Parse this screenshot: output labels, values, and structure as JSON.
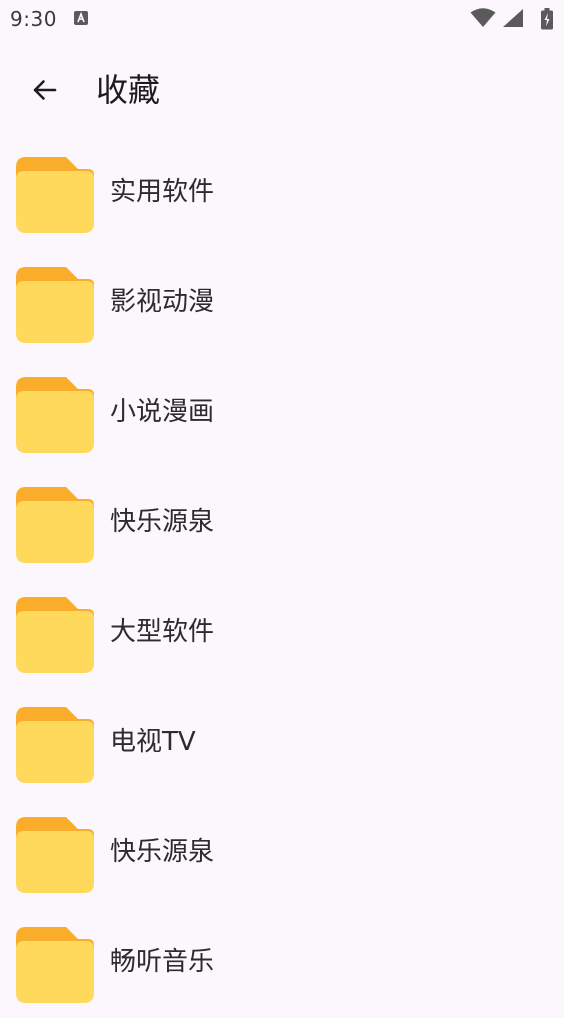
{
  "status_bar": {
    "time": "9:30",
    "icons": [
      "a-notification-icon",
      "wifi-icon",
      "signal-icon",
      "battery-icon"
    ]
  },
  "app_bar": {
    "back_icon": "arrow-back-icon",
    "title": "收藏"
  },
  "folders": [
    {
      "label": "实用软件"
    },
    {
      "label": "影视动漫"
    },
    {
      "label": "小说漫画"
    },
    {
      "label": "快乐源泉"
    },
    {
      "label": "大型软件"
    },
    {
      "label": "电视TV"
    },
    {
      "label": "快乐源泉"
    },
    {
      "label": "畅听音乐"
    }
  ],
  "colors": {
    "background": "#fcf7fc",
    "folder_back": "#f9ad2a",
    "folder_front": "#ffd95c"
  }
}
